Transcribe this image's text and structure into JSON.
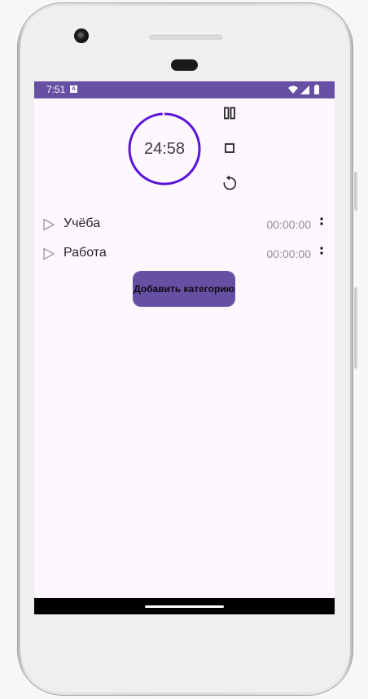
{
  "status_bar": {
    "time": "7:51",
    "notification_icon": "a-box-icon",
    "icons": [
      "wifi-icon",
      "signal-icon",
      "battery-icon"
    ]
  },
  "timer": {
    "display": "24:58",
    "ring_color": "#5b12d9",
    "progress_fraction": 0.99
  },
  "controls": {
    "pause_icon": "pause-icon",
    "stop_icon": "stop-icon",
    "reset_icon": "restart-icon"
  },
  "categories": [
    {
      "name": "Учёба",
      "time": "00:00:00"
    },
    {
      "name": "Работа",
      "time": "00:00:00"
    }
  ],
  "add_button": {
    "label": "Добавить категорию"
  },
  "colors": {
    "accent": "#6750a4",
    "background": "#fdf7fe"
  }
}
